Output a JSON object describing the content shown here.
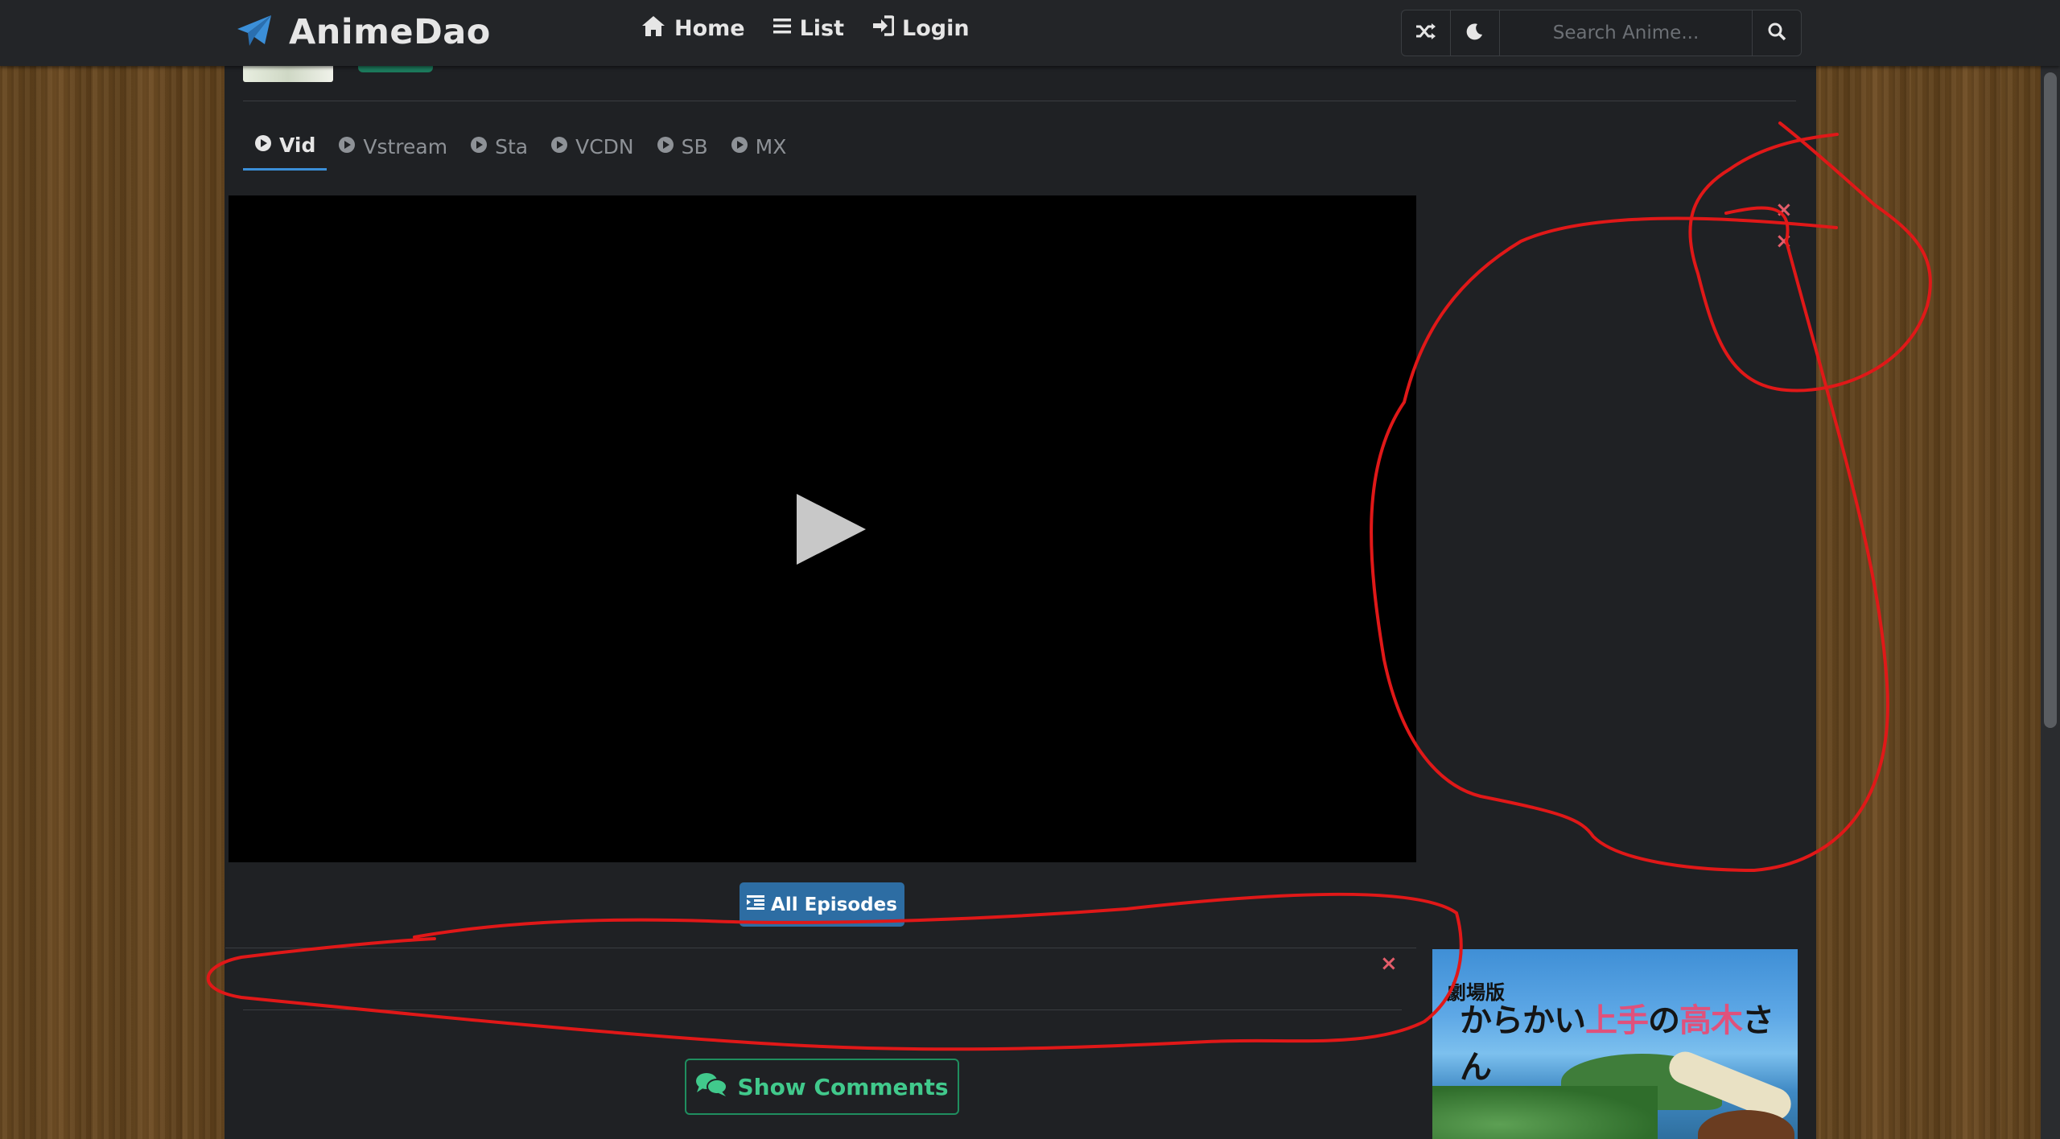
{
  "navbar": {
    "brand": "AnimeDao",
    "links": [
      {
        "label": "Home",
        "icon": "home-icon"
      },
      {
        "label": "List",
        "icon": "list-icon"
      },
      {
        "label": "Login",
        "icon": "login-icon"
      }
    ],
    "search_placeholder": "Search Anime..."
  },
  "server_tabs": [
    {
      "label": "Vid",
      "active": true
    },
    {
      "label": "Vstream",
      "active": false
    },
    {
      "label": "Sta",
      "active": false
    },
    {
      "label": "VCDN",
      "active": false
    },
    {
      "label": "SB",
      "active": false
    },
    {
      "label": "MX",
      "active": false
    }
  ],
  "buttons": {
    "all_episodes": "All Episodes",
    "show_comments": "Show Comments"
  },
  "close_marks": [
    "×",
    "×",
    "×"
  ],
  "ad": {
    "title_line1": "劇場版",
    "title_line2_a": "からかい",
    "title_line2_b": "上手",
    "title_line2_c": "の",
    "title_line2_d": "高木",
    "title_line2_e": "さん"
  },
  "colors": {
    "accent": "#3b8fd8",
    "navbar_bg": "#232528",
    "page_bg": "#1f2124",
    "episodes_button": "#2d6da3",
    "comments_green": "#41c98c",
    "close_red": "#e35d6a",
    "annotation_red": "#e01818"
  }
}
